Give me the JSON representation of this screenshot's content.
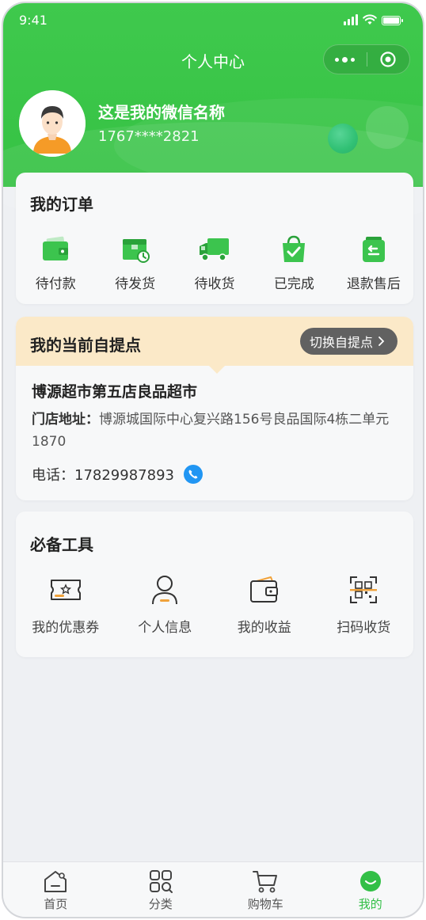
{
  "status_bar": {
    "time": "9:41"
  },
  "nav": {
    "title": "个人中心"
  },
  "user": {
    "nickname": "这是我的微信名称",
    "phone": "1767****2821"
  },
  "orders": {
    "title": "我的订单",
    "items": [
      {
        "label": "待付款",
        "icon": "wallet-icon"
      },
      {
        "label": "待发货",
        "icon": "package-clock-icon"
      },
      {
        "label": "待收货",
        "icon": "truck-icon"
      },
      {
        "label": "已完成",
        "icon": "bag-check-icon"
      },
      {
        "label": "退款售后",
        "icon": "refund-icon"
      }
    ]
  },
  "pickup": {
    "title": "我的当前自提点",
    "switch_label": "切换自提点",
    "store_name": "博源超市第五店良品超市",
    "address_label": "门店地址：",
    "address": "博源城国际中心复兴路156号良品国际4栋二单元1870",
    "tel_label": "电话：",
    "tel": "17829987893"
  },
  "tools": {
    "title": "必备工具",
    "items": [
      {
        "label": "我的优惠券",
        "icon": "coupon-icon"
      },
      {
        "label": "个人信息",
        "icon": "person-icon"
      },
      {
        "label": "我的收益",
        "icon": "wallet-outline-icon"
      },
      {
        "label": "扫码收货",
        "icon": "qr-scan-icon"
      }
    ]
  },
  "tabbar": [
    {
      "label": "首页",
      "icon": "home-icon"
    },
    {
      "label": "分类",
      "icon": "category-icon"
    },
    {
      "label": "购物车",
      "icon": "cart-icon"
    },
    {
      "label": "我的",
      "icon": "profile-icon",
      "active": true
    }
  ],
  "colors": {
    "brand_green": "#36c244",
    "pickup_header": "#fbe9c8",
    "phone_blue": "#2196f3",
    "active_tab": "#32bf46"
  }
}
